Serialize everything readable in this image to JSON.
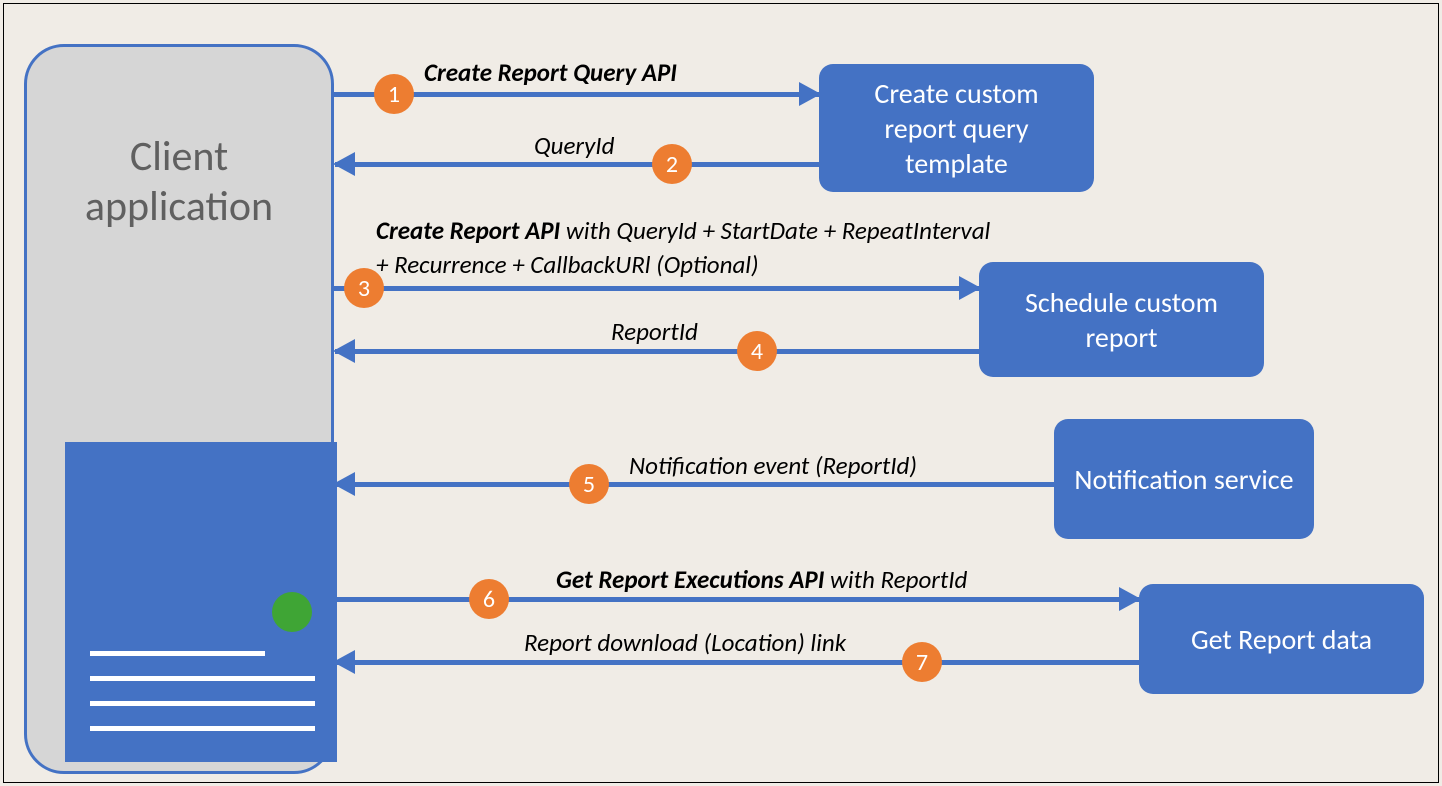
{
  "client": {
    "title_line1": "Client",
    "title_line2": "application"
  },
  "boxes": {
    "b1": "Create custom report query template",
    "b2": "Schedule custom report",
    "b3": "Notification service",
    "b4": "Get Report data"
  },
  "steps": {
    "s1": {
      "num": "1",
      "label_bold": "Create Report Query API"
    },
    "s2": {
      "num": "2",
      "label_it": "QueryId"
    },
    "s3": {
      "num": "3",
      "label_bold": "Create Report API",
      "label_it": " with QueryId + StartDate + RepeatInterval + Recurrence + CallbackURl (Optional)"
    },
    "s4": {
      "num": "4",
      "label_it": "ReportId"
    },
    "s5": {
      "num": "5",
      "label_it": "Notification event (ReportId)"
    },
    "s6": {
      "num": "6",
      "label_bold": "Get Report Executions API",
      "label_it": " with ReportId"
    },
    "s7": {
      "num": "7",
      "label_it": "Report download (Location) link"
    }
  }
}
